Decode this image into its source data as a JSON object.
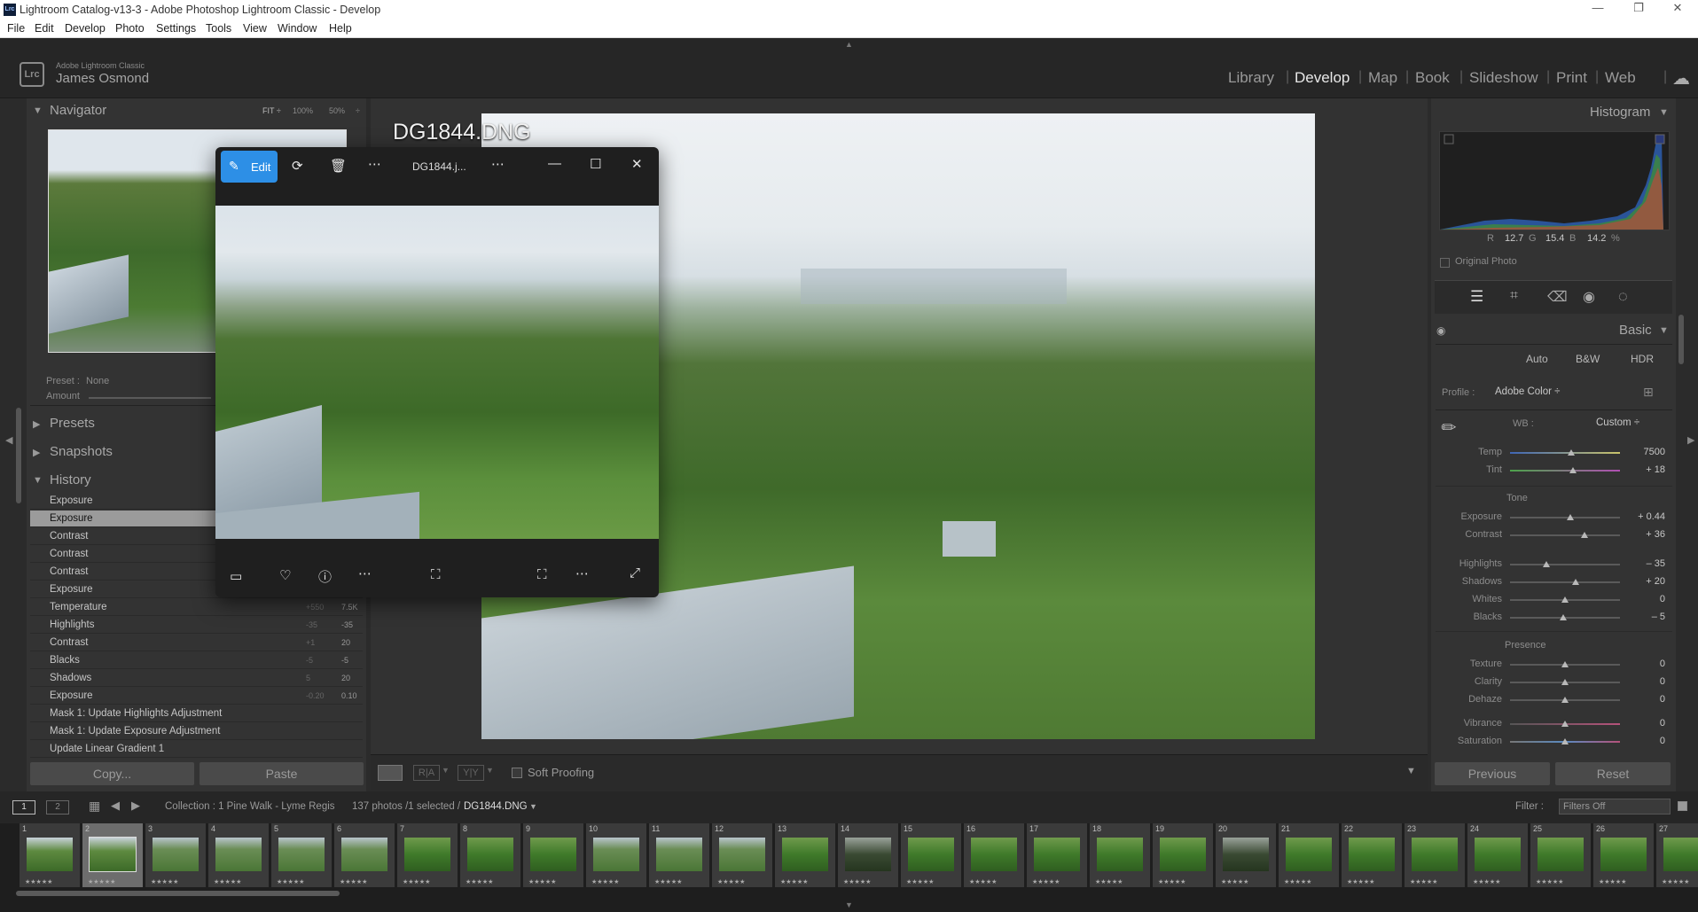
{
  "window": {
    "title": "Lightroom Catalog-v13-3 - Adobe Photoshop Lightroom Classic - Develop",
    "app_icon": "Lrc",
    "controls": [
      "minimize-icon",
      "restore-icon",
      "close-icon"
    ]
  },
  "menu": [
    "File",
    "Edit",
    "Develop",
    "Photo",
    "Settings",
    "Tools",
    "View",
    "Window",
    "Help"
  ],
  "identity": {
    "product": "Adobe Lightroom Classic",
    "user": "James Osmond",
    "logo": "Lrc"
  },
  "modules": [
    "Library",
    "Develop",
    "Map",
    "Book",
    "Slideshow",
    "Print",
    "Web"
  ],
  "active_module": "Develop",
  "left_panel": {
    "navigator": {
      "title": "Navigator",
      "zoom_options": [
        "FIT ÷",
        "100%",
        "50%",
        "÷"
      ]
    },
    "preset": {
      "label": "Preset :",
      "value": "None",
      "amount_label": "Amount"
    },
    "sections": [
      "Presets",
      "Snapshots",
      "History"
    ],
    "history": [
      {
        "label": "Exposure",
        "a": "",
        "b": ""
      },
      {
        "label": "Exposure",
        "a": "",
        "b": "",
        "selected": true
      },
      {
        "label": "Contrast",
        "a": "",
        "b": ""
      },
      {
        "label": "Contrast",
        "a": "",
        "b": ""
      },
      {
        "label": "Contrast",
        "a": "",
        "b": ""
      },
      {
        "label": "Exposure",
        "a": "",
        "b": ""
      },
      {
        "label": "Temperature",
        "a": "+550",
        "b": "7.5K"
      },
      {
        "label": "Highlights",
        "a": "-35",
        "b": "-35"
      },
      {
        "label": "Contrast",
        "a": "+1",
        "b": "20"
      },
      {
        "label": "Blacks",
        "a": "-5",
        "b": "-5"
      },
      {
        "label": "Shadows",
        "a": "5",
        "b": "20"
      },
      {
        "label": "Exposure",
        "a": "-0.20",
        "b": "0.10"
      },
      {
        "label": "Mask 1: Update Highlights Adjustment",
        "a": "",
        "b": ""
      },
      {
        "label": "Mask 1: Update Exposure Adjustment",
        "a": "",
        "b": ""
      },
      {
        "label": "Update Linear Gradient 1",
        "a": "",
        "b": ""
      }
    ],
    "copy_button": "Copy...",
    "paste_button": "Paste"
  },
  "center": {
    "filename_overlay": "DG1844.DNG",
    "toolbar": {
      "soft_proofing_label": "Soft Proofing",
      "soft_proofing_checked": false
    }
  },
  "photos_app": {
    "edit_label": "Edit",
    "filename": "DG1844.j...",
    "bottom_icons": [
      "filmstrip-icon",
      "heart-icon",
      "info-icon",
      "more-icon",
      "crop-icon",
      "fit-icon",
      "more-icon",
      "fullscreen-icon"
    ]
  },
  "right_panel": {
    "histogram": {
      "title": "Histogram",
      "readout": {
        "r_label": "R",
        "r": "12.7",
        "g_label": "G",
        "g": "15.4",
        "b_label": "B",
        "b": "14.2",
        "pct": "%"
      },
      "original_photo_label": "Original Photo"
    },
    "tools": [
      "edit-sliders-icon",
      "crop-icon",
      "heal-icon",
      "redeye-icon",
      "masking-icon"
    ],
    "basic": {
      "title": "Basic",
      "modes": [
        "Auto",
        "B&W",
        "HDR"
      ],
      "profile_label": "Profile :",
      "profile_value": "Adobe Color ÷",
      "wb_label": "WB :",
      "wb_value": "Custom ÷",
      "sliders": [
        {
          "label": "Temp",
          "value": "7500",
          "pos": 0.56
        },
        {
          "label": "Tint",
          "value": "+ 18",
          "pos": 0.57
        }
      ],
      "tone_title": "Tone",
      "tone": [
        {
          "label": "Exposure",
          "value": "+ 0.44",
          "pos": 0.55
        },
        {
          "label": "Contrast",
          "value": "+ 36",
          "pos": 0.68
        },
        {
          "label": "Highlights",
          "value": "– 35",
          "pos": 0.33
        },
        {
          "label": "Shadows",
          "value": "+ 20",
          "pos": 0.6
        },
        {
          "label": "Whites",
          "value": "0",
          "pos": 0.5
        },
        {
          "label": "Blacks",
          "value": "– 5",
          "pos": 0.48
        }
      ],
      "presence_title": "Presence",
      "presence": [
        {
          "label": "Texture",
          "value": "0",
          "pos": 0.5
        },
        {
          "label": "Clarity",
          "value": "0",
          "pos": 0.5
        },
        {
          "label": "Dehaze",
          "value": "0",
          "pos": 0.5
        },
        {
          "label": "Vibrance",
          "value": "0",
          "pos": 0.5
        },
        {
          "label": "Saturation",
          "value": "0",
          "pos": 0.5
        }
      ]
    },
    "previous_button": "Previous",
    "reset_button": "Reset"
  },
  "filmstrip_bar": {
    "pages": [
      "1",
      "2"
    ],
    "collection": "Collection : 1 Pine Walk - Lyme Regis",
    "count": "137 photos /1 selected /",
    "current": "DG1844.DNG",
    "filter_label": "Filter :",
    "filter_value": "Filters Off"
  },
  "filmstrip": [
    {
      "num": "1",
      "stars": "★★★★★",
      "tone": "light"
    },
    {
      "num": "2",
      "stars": "★★★★★",
      "tone": "light",
      "selected": true
    },
    {
      "num": "3",
      "stars": "★★★★★",
      "tone": "mid"
    },
    {
      "num": "4",
      "stars": "★★★★★",
      "tone": "mid"
    },
    {
      "num": "5",
      "stars": "★★★★★",
      "tone": "mid"
    },
    {
      "num": "6",
      "stars": "★★★★★",
      "tone": "mid"
    },
    {
      "num": "7",
      "stars": "★★★★★",
      "tone": "green"
    },
    {
      "num": "8",
      "stars": "★★★★★",
      "tone": "green"
    },
    {
      "num": "9",
      "stars": "★★★★★",
      "tone": "green"
    },
    {
      "num": "10",
      "stars": "★★★★★",
      "tone": "mid"
    },
    {
      "num": "11",
      "stars": "★★★★★",
      "tone": "mid"
    },
    {
      "num": "12",
      "stars": "★★★★★",
      "tone": "mid"
    },
    {
      "num": "13",
      "stars": "★★★★★",
      "tone": "green"
    },
    {
      "num": "14",
      "stars": "★★★★★",
      "tone": "dark"
    },
    {
      "num": "15",
      "stars": "★★★★★",
      "tone": "green"
    },
    {
      "num": "16",
      "stars": "★★★★★",
      "tone": "green"
    },
    {
      "num": "17",
      "stars": "★★★★★",
      "tone": "green"
    },
    {
      "num": "18",
      "stars": "★★★★★",
      "tone": "green"
    },
    {
      "num": "19",
      "stars": "★★★★★",
      "tone": "green"
    },
    {
      "num": "20",
      "stars": "★★★★★",
      "tone": "dark"
    },
    {
      "num": "21",
      "stars": "★★★★★",
      "tone": "green"
    },
    {
      "num": "22",
      "stars": "★★★★★",
      "tone": "green"
    },
    {
      "num": "23",
      "stars": "★★★★★",
      "tone": "green"
    },
    {
      "num": "24",
      "stars": "★★★★★",
      "tone": "green"
    },
    {
      "num": "25",
      "stars": "★★★★★",
      "tone": "green"
    },
    {
      "num": "26",
      "stars": "★★★★★",
      "tone": "green"
    },
    {
      "num": "27",
      "stars": "★★★★★",
      "tone": "green"
    }
  ],
  "colors": {
    "accent": "#0a84d6",
    "panel": "#333333",
    "bg": "#2b2b2b",
    "selected_row": "#9b9b9b"
  }
}
